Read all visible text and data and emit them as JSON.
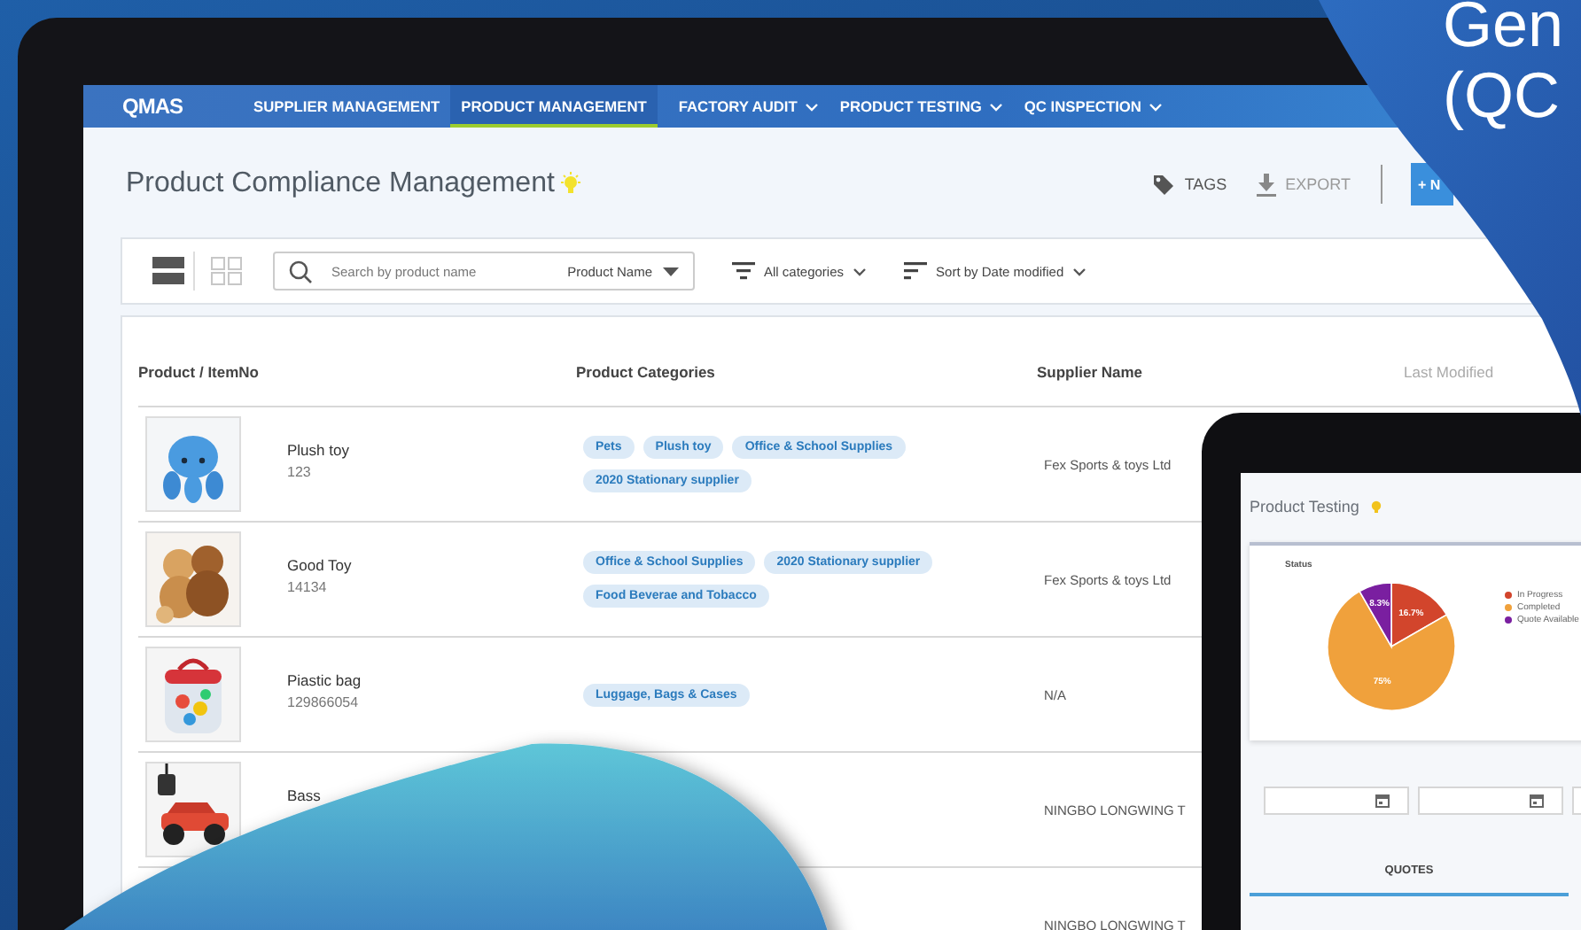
{
  "nav": {
    "logo": "QMAS",
    "items": [
      {
        "label": "SUPPLIER MANAGEMENT",
        "selected": false,
        "dropdown": false
      },
      {
        "label": "PRODUCT MANAGEMENT",
        "selected": true,
        "dropdown": false
      },
      {
        "label": "FACTORY AUDIT",
        "selected": false,
        "dropdown": true
      },
      {
        "label": "PRODUCT TESTING",
        "selected": false,
        "dropdown": true
      },
      {
        "label": "QC INSPECTION",
        "selected": false,
        "dropdown": true
      }
    ]
  },
  "page": {
    "title": "Product Compliance Management",
    "actions": [
      {
        "kind": "tags",
        "label": "TAGS"
      },
      {
        "kind": "export",
        "label": "EXPORT"
      }
    ],
    "new_button": "+ N"
  },
  "toolbar": {
    "views": [
      {
        "kind": "list",
        "selected": true
      },
      {
        "kind": "grid",
        "selected": false
      }
    ],
    "search": {
      "placeholder": "Search by product name",
      "field": "Product Name"
    },
    "filter": "All categories",
    "sort": "Sort by Date modified"
  },
  "table": {
    "columns": [
      "Product / ItemNo",
      "Product Categories",
      "Supplier Name",
      "Last Modified"
    ],
    "rows": [
      {
        "thumbnail": {
          "kind": "picture"
        },
        "name": "Plush toy",
        "item_no": "123",
        "categories": [
          "Pets",
          "Plush toy",
          "Office & School Supplies",
          "2020 Stationary supplier"
        ],
        "supplier": "Fex Sports & toys Ltd"
      },
      {
        "thumbnail": {
          "kind": "picture"
        },
        "name": "Good Toy",
        "item_no": "14134",
        "categories": [
          "Office & School Supplies",
          "2020 Stationary supplier",
          "Food Beverae and Tobacco"
        ],
        "supplier": "Fex Sports & toys Ltd"
      },
      {
        "thumbnail": {
          "kind": "picture"
        },
        "name": "Piastic bag",
        "item_no": "129866054",
        "categories": [
          "Luggage, Bags & Cases"
        ],
        "supplier": "N/A"
      },
      {
        "thumbnail": {
          "kind": "picture"
        },
        "name": "Bass",
        "supplier": "NINGBO LONGWING T"
      },
      {
        "supplier": "NINGBO LONGWING T"
      }
    ]
  },
  "tablet": {
    "title": "Product Testing",
    "slices": [
      {
        "color": "#d2452c"
      },
      {
        "color": "#f0a13c"
      },
      {
        "color": "#7a1fa0"
      }
    ],
    "chart_data": {
      "type": "pie",
      "title": "Status",
      "categories": [
        "In Progress",
        "Completed",
        "Quote Available"
      ],
      "values": [
        16.7,
        75,
        8.3
      ],
      "value_labels": [
        "16.7%",
        "75%",
        "8.3%"
      ],
      "legend": true
    },
    "date_fields": [
      {
        "kind": "date"
      },
      {
        "kind": "date"
      },
      {
        "kind": "field"
      }
    ],
    "tab": "QUOTES"
  },
  "headline": {
    "lines": [
      "Gen",
      "(QC"
    ]
  }
}
